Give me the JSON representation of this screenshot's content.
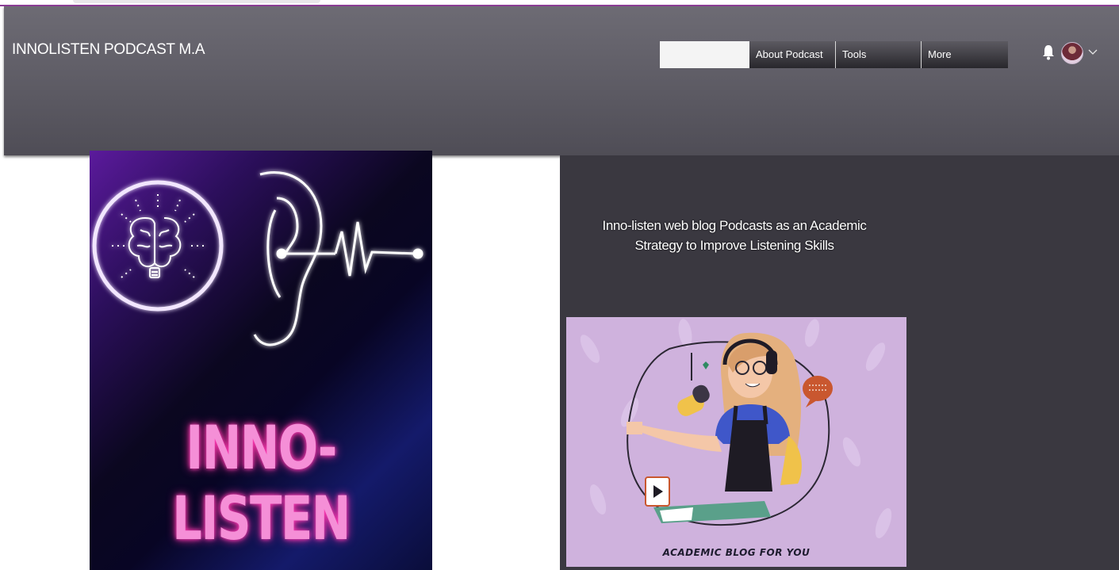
{
  "header": {
    "site_title": "INNOLISTEN PODCAST M.A",
    "nav": [
      {
        "label": "About Podcast"
      },
      {
        "label": "Tools"
      },
      {
        "label": "More"
      }
    ],
    "icons": [
      "bell-icon",
      "avatar",
      "chevron-down-icon"
    ]
  },
  "cover": {
    "title": "INNO- LISTEN",
    "icons": [
      "brain-lightbulb-icon",
      "ear-soundwave-icon"
    ]
  },
  "main": {
    "headline_line1": "Inno-listen web blog Podcasts as an Academic",
    "headline_line2": "Strategy to Improve Listening Skills",
    "blog_image_caption": "ACADEMIC BLOG FOR YOU"
  },
  "colors": {
    "header_bg": "#5d5b64",
    "panel_bg": "#3a3840",
    "accent_pink": "#f58fd7",
    "blog_bg": "#cfb2dd"
  }
}
